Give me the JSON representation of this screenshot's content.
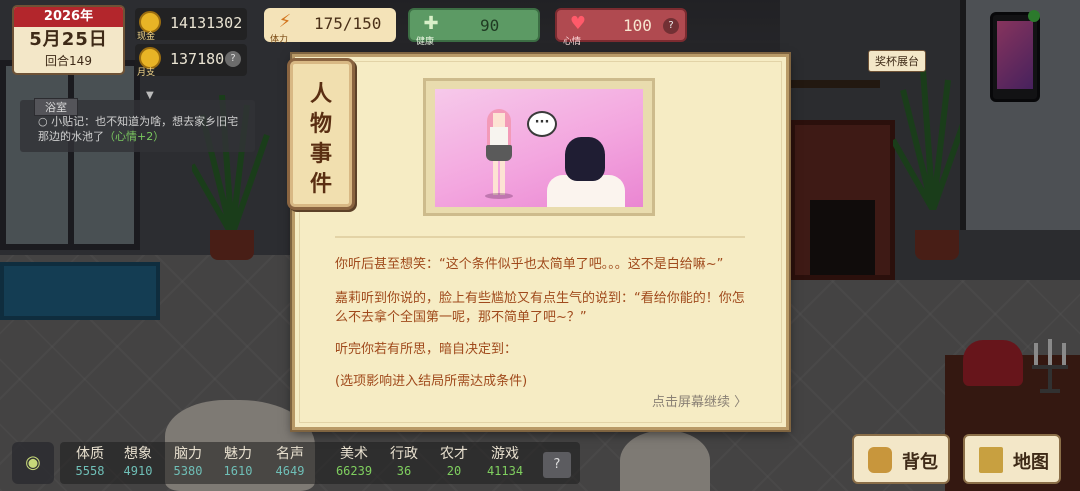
{
  "calendar": {
    "year": "2026年",
    "date": "5月25日",
    "round": "回合149"
  },
  "money": {
    "cash": {
      "tag": "现金",
      "value": "14131302"
    },
    "monthly": {
      "tag": "月支",
      "value": "137180",
      "help": "?"
    }
  },
  "stats": {
    "energy": {
      "icon": "lightning-icon",
      "label": "体力",
      "value": "175/150"
    },
    "health": {
      "icon": "health-cross-icon",
      "label": "健康",
      "value": "90"
    },
    "mood": {
      "icon": "heart-icon",
      "label": "心情",
      "value": "100",
      "help": "?"
    }
  },
  "trophy_label": "奖杯展台",
  "quest": {
    "title": "浴室",
    "text": "小贴记：也不知道为啥，想去家乡旧宅那边的水池了",
    "reward": "（心情+2）"
  },
  "attributes": [
    {
      "name": "体质",
      "value": "5558"
    },
    {
      "name": "想象",
      "value": "4910"
    },
    {
      "name": "脑力",
      "value": "5380"
    },
    {
      "name": "魅力",
      "value": "1610"
    },
    {
      "name": "名声",
      "value": "4649"
    },
    {
      "name": "美术",
      "value": "66239"
    },
    {
      "name": "行政",
      "value": "36"
    },
    {
      "name": "农才",
      "value": "20"
    },
    {
      "name": "游戏",
      "value": "41134"
    }
  ],
  "attr_help": "?",
  "buttons": {
    "bag": "背包",
    "map": "地图"
  },
  "dialog": {
    "tag": [
      "人",
      "物",
      "事",
      "件"
    ],
    "bubble": "···",
    "paragraph1": "你听后甚至想笑：“这个条件似乎也太简单了吧。。。这不是白给嘛~”",
    "paragraph2": "嘉莉听到你说的，脸上有些尴尬又有点生气的说到：“看给你能的！你怎么不去拿个全国第一呢，那不简单了吧~？”",
    "paragraph3": "听完你若有所思，暗自决定到：",
    "paragraph4": "(选项影响进入结局所需达成条件)",
    "continue": "点击屏幕继续 〉"
  },
  "colors": {
    "dialog_bg": "#f6ecc4",
    "dialog_text": "#a04a1c",
    "calendar_header": "#b3262c",
    "health_green": "#5c9a64",
    "mood_red": "#b04a50"
  }
}
